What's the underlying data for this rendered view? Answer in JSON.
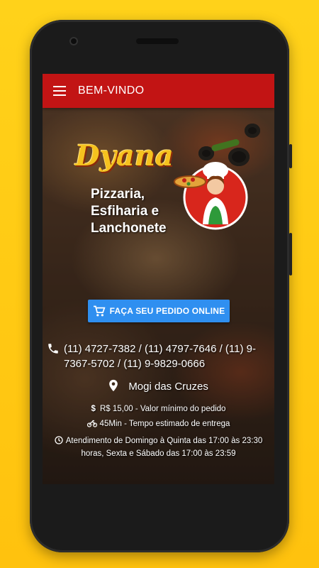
{
  "appbar": {
    "title": "BEM-VINDO",
    "menu_icon": "menu-icon"
  },
  "logo": {
    "script": "Dyana",
    "subtitle_lines": [
      "Pizzaria,",
      "Esfiharia e",
      "Lanchonete"
    ]
  },
  "order_button": {
    "label": "FAÇA SEU PEDIDO ONLINE",
    "icon": "cart-icon"
  },
  "contact": {
    "phones": "(11) 4727-7382 / (11) 4797-7646 / (11) 9-7367-5702 / (11) 9-9829-0666",
    "city": "Mogi das Cruzes"
  },
  "info": {
    "min_order": "R$ 15,00 - Valor mínimo do pedido",
    "delivery_time": "45Min - Tempo estimado de entrega",
    "hours": "Atendimento de Domingo à Quinta das 17:00 às 23:30 horas, Sexta e Sábado das 17:00 às 23:59"
  },
  "colors": {
    "background": "#ffc20e",
    "appbar": "#c21414",
    "button": "#2f8ff0",
    "text": "#ffffff"
  }
}
